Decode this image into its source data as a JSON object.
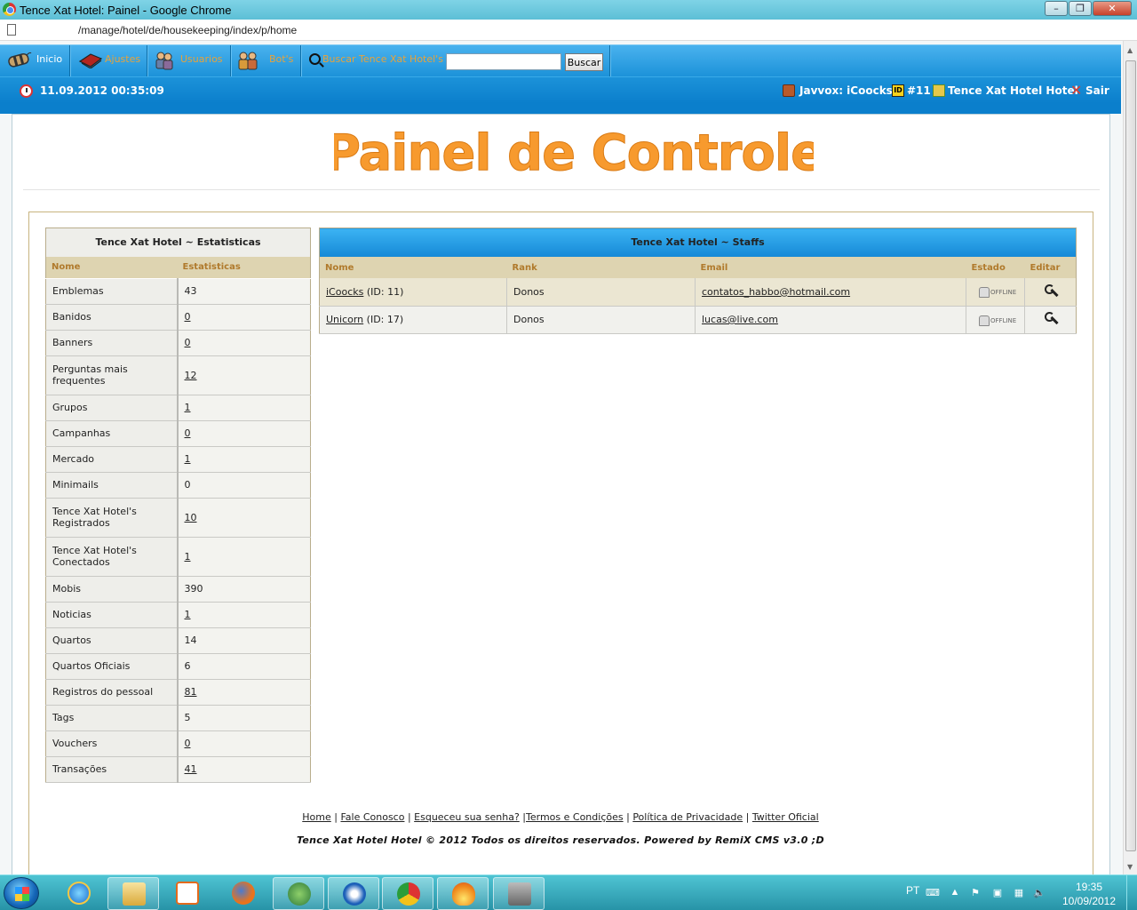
{
  "window": {
    "title": "Tence Xat Hotel: Painel - Google Chrome",
    "url": "/manage/hotel/de/housekeeping/index/p/home"
  },
  "nav": {
    "items": [
      {
        "label": "Inicio",
        "icon": "dynamite-icon"
      },
      {
        "label": "Ajustes",
        "icon": "book-icon"
      },
      {
        "label": "Usuarios",
        "icon": "users-icon"
      },
      {
        "label": "Bot's",
        "icon": "bots-icon"
      }
    ],
    "search_label": "Buscar Tence Xat Hotel's",
    "search_value": "",
    "search_button": "Buscar"
  },
  "subnav": {
    "datetime": "11.09.2012 00:35:09",
    "user": "Javvox: iCoocks",
    "user_id": "#11",
    "hotel": "Tence Xat Hotel Hotel",
    "logout": "Sair"
  },
  "logo_text": "Painel de Controle",
  "stats": {
    "title": "Tence Xat Hotel ~ Estatisticas",
    "headers": [
      "Nome",
      "Estatisticas"
    ],
    "rows": [
      {
        "name": "Emblemas",
        "value": "43",
        "link": false
      },
      {
        "name": "Banidos",
        "value": "0",
        "link": true
      },
      {
        "name": "Banners",
        "value": "0",
        "link": true
      },
      {
        "name": "Perguntas mais frequentes",
        "value": "12",
        "link": true
      },
      {
        "name": "Grupos",
        "value": "1",
        "link": true
      },
      {
        "name": "Campanhas",
        "value": "0",
        "link": true
      },
      {
        "name": "Mercado",
        "value": "1",
        "link": true
      },
      {
        "name": "Minimails",
        "value": "0",
        "link": false
      },
      {
        "name": "Tence Xat Hotel's Registrados",
        "value": "10",
        "link": true
      },
      {
        "name": "Tence Xat Hotel's Conectados",
        "value": "1",
        "link": true
      },
      {
        "name": "Mobis",
        "value": "390",
        "link": false
      },
      {
        "name": "Noticias",
        "value": "1",
        "link": true
      },
      {
        "name": "Quartos",
        "value": "14",
        "link": false
      },
      {
        "name": "Quartos Oficiais",
        "value": "6",
        "link": false
      },
      {
        "name": "Registros do pessoal",
        "value": "81",
        "link": true
      },
      {
        "name": "Tags",
        "value": "5",
        "link": false
      },
      {
        "name": "Vouchers",
        "value": "0",
        "link": true
      },
      {
        "name": "Transações",
        "value": "41",
        "link": true
      }
    ]
  },
  "staffs": {
    "title": "Tence Xat Hotel ~ Staffs",
    "headers": [
      "Nome",
      "Rank",
      "Email",
      "Estado",
      "Editar"
    ],
    "rows": [
      {
        "name": "iCoocks",
        "id": "(ID: 11)",
        "rank": "Donos",
        "email": "contatos_habbo@hotmail.com",
        "status": "OFFLINE"
      },
      {
        "name": "Unicorn",
        "id": "(ID: 17)",
        "rank": "Donos",
        "email": "lucas@live.com",
        "status": "OFFLINE"
      }
    ]
  },
  "footer": {
    "links": [
      "Home",
      "Fale Conosco",
      "Esqueceu sua senha?",
      "Termos e Condições",
      "Política de Privacidade",
      "Twitter Oficial"
    ],
    "copyright": "Tence Xat Hotel Hotel © 2012 Todos os direitos reservados. Powered by RemiX CMS v3.0 ;D"
  },
  "taskbar": {
    "language": "PT",
    "time": "19:35",
    "date": "10/09/2012"
  },
  "colors": {
    "nav_blue": "#1c92d9",
    "nav_text": "#e8a23a",
    "header_beige": "#ded4b1",
    "logo_orange": "#f79a2e"
  }
}
